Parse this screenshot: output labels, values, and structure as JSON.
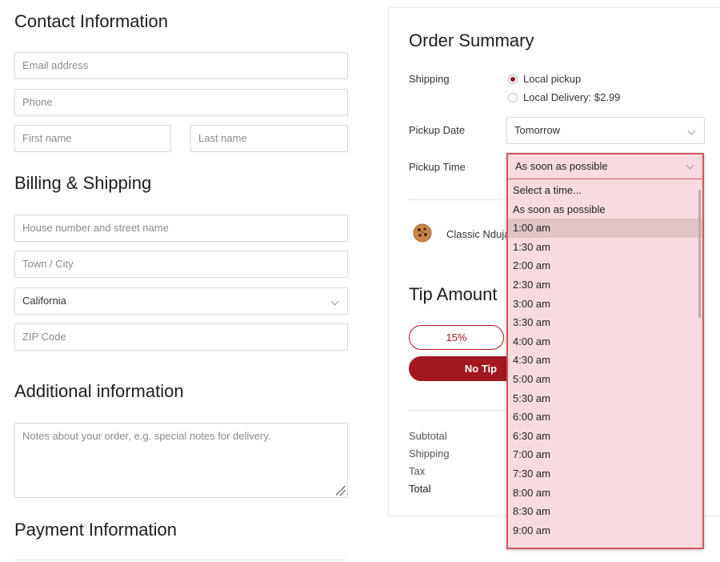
{
  "contact": {
    "heading": "Contact Information",
    "email_placeholder": "Email address",
    "phone_placeholder": "Phone",
    "first_name_placeholder": "First name",
    "last_name_placeholder": "Last name"
  },
  "billing": {
    "heading": "Billing & Shipping",
    "street_placeholder": "House number and street name",
    "city_placeholder": "Town / City",
    "state_value": "California",
    "zip_placeholder": "ZIP Code"
  },
  "additional": {
    "heading": "Additional information",
    "notes_placeholder": "Notes about your order, e.g. special notes for delivery."
  },
  "payment": {
    "heading": "Payment Information"
  },
  "order_summary": {
    "heading": "Order Summary",
    "shipping_label": "Shipping",
    "shipping_options": [
      "Local pickup",
      "Local Delivery: $2.99"
    ],
    "pickup_date_label": "Pickup Date",
    "pickup_date_value": "Tomorrow",
    "pickup_time_label": "Pickup Time",
    "pickup_time_value": "As soon as possible",
    "item_name": "Classic Nduja",
    "tip_heading": "Tip Amount",
    "tip_15": "15%",
    "no_tip": "No Tip",
    "subtotal_label": "Subtotal",
    "shipping_total_label": "Shipping",
    "tax_label": "Tax",
    "total_label": "Total"
  },
  "time_options": [
    "Select a time...",
    "As soon as possible",
    "1:00 am",
    "1:30 am",
    "2:00 am",
    "2:30 am",
    "3:00 am",
    "3:30 am",
    "4:00 am",
    "4:30 am",
    "5:00 am",
    "5:30 am",
    "6:00 am",
    "6:30 am",
    "7:00 am",
    "7:30 am",
    "8:00 am",
    "8:30 am",
    "9:00 am"
  ],
  "highlighted_option": "1:00 am",
  "colors": {
    "accent": "#a3171f",
    "dropdown_bg": "#f7dbde",
    "dropdown_border": "#d9535a"
  }
}
